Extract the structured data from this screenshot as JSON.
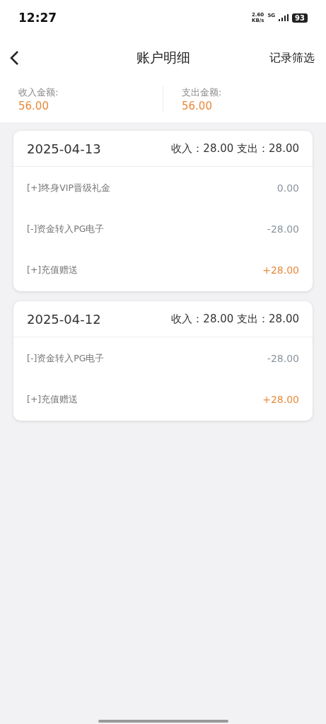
{
  "status_bar": {
    "time": "12:27",
    "speed": "2.60",
    "speed_unit": "KB/s",
    "network": "5G",
    "battery": "93"
  },
  "nav": {
    "title": "账户明细",
    "action": "记录筛选"
  },
  "summary": [
    {
      "label": "收入金额:",
      "value": "56.00"
    },
    {
      "label": "支出金额:",
      "value": "56.00"
    }
  ],
  "days": [
    {
      "date": "2025-04-13",
      "totals": "收入：28.00 支出：28.00",
      "rows": [
        {
          "name": "[+]终身VIP晋级礼金",
          "amount": "0.00",
          "kind": "other"
        },
        {
          "name": "[-]资金转入PG电子",
          "amount": "-28.00",
          "kind": "other"
        },
        {
          "name": "[+]充值赠送",
          "amount": "+28.00",
          "kind": "gain"
        }
      ]
    },
    {
      "date": "2025-04-12",
      "totals": "收入：28.00 支出：28.00",
      "rows": [
        {
          "name": "[-]资金转入PG电子",
          "amount": "-28.00",
          "kind": "other"
        },
        {
          "name": "[+]充值赠送",
          "amount": "+28.00",
          "kind": "gain"
        }
      ]
    }
  ]
}
